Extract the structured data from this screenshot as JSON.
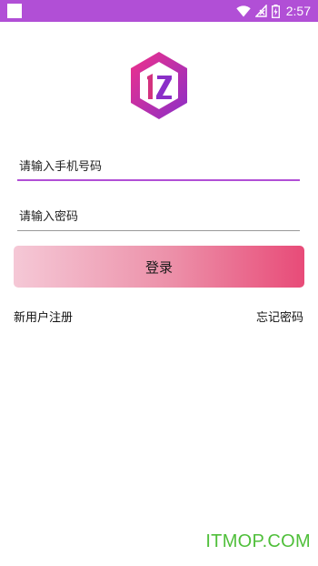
{
  "status_bar": {
    "time": "2:57",
    "icons": [
      "wifi-icon",
      "signal-icon",
      "battery-charging-icon"
    ],
    "color": "#b14fd6"
  },
  "logo": {
    "text": "IZ",
    "colors": [
      "#e8307a",
      "#8a2fc8"
    ]
  },
  "form": {
    "phone_placeholder": "请输入手机号码",
    "password_placeholder": "请输入密码",
    "login_label": "登录"
  },
  "links": {
    "register": "新用户注册",
    "forgot_password": "忘记密码"
  },
  "watermark": "ITMOP.COM"
}
